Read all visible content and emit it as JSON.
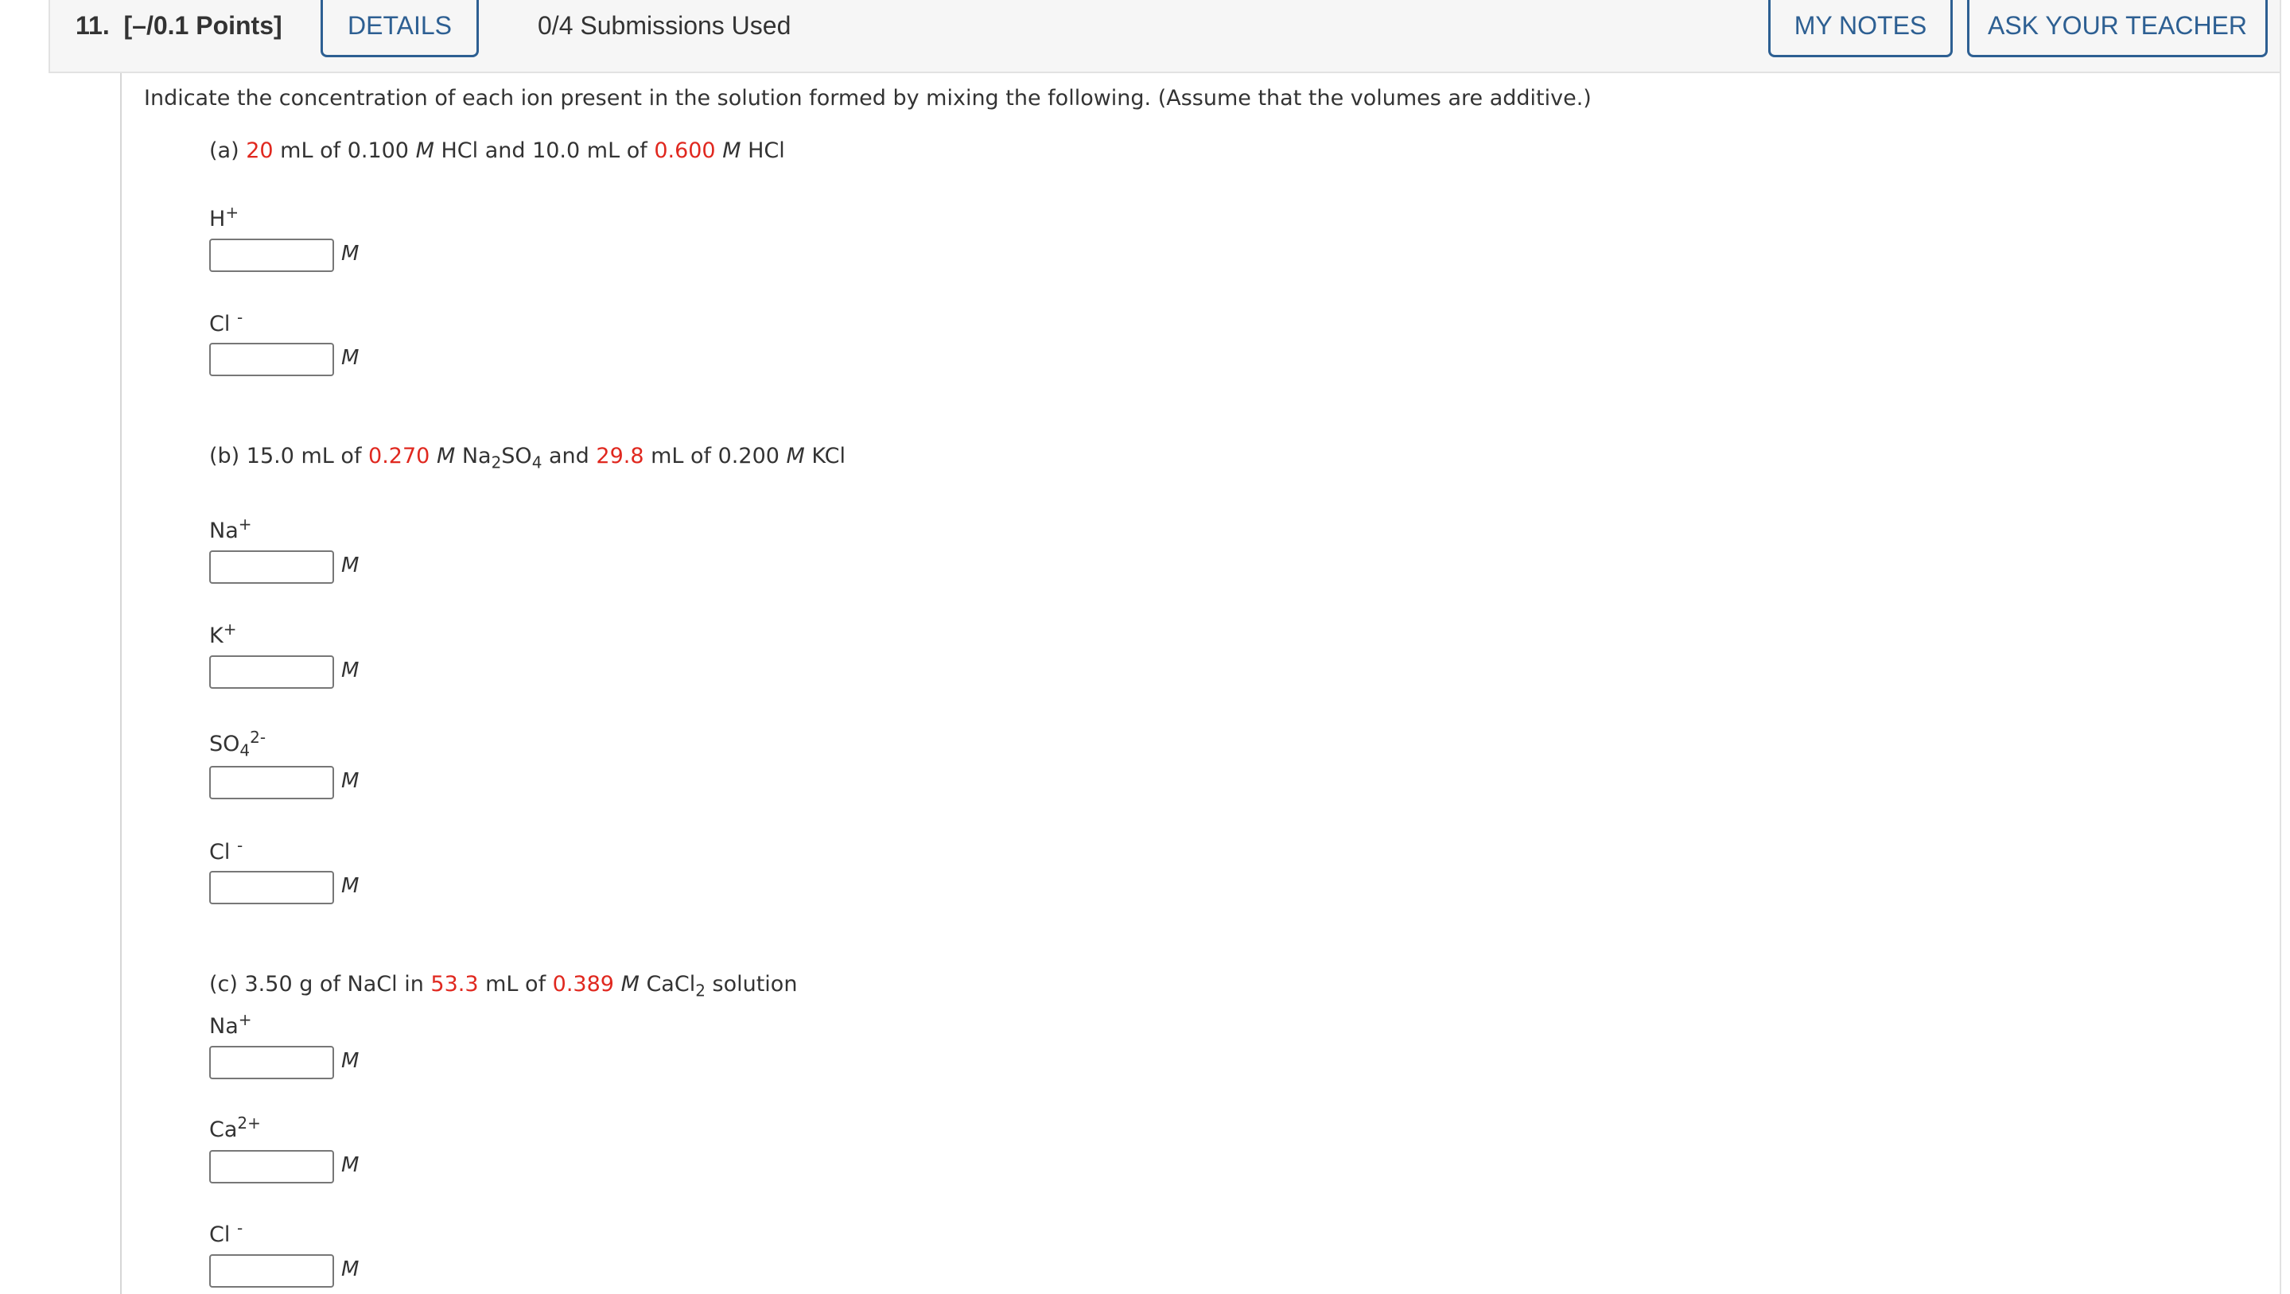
{
  "header": {
    "question_number": "11.",
    "points": "[–/0.1 Points]",
    "details_label": "DETAILS",
    "submissions": "0/4 Submissions Used",
    "my_notes_label": "MY NOTES",
    "ask_teacher_label": "ASK YOUR TEACHER"
  },
  "question": {
    "instruction": "Indicate the concentration of each ion present in the solution formed by mixing the following. (Assume that the volumes are additive.)",
    "unit": "M",
    "parts": [
      {
        "label": "(a)",
        "text": {
          "v1": "20",
          "t1": " mL of 0.100 ",
          "m1": "M",
          "t2": " HCl and 10.0 mL of ",
          "v2": "0.600",
          "t3": " ",
          "m2": "M",
          "t4": " HCl"
        },
        "ions": [
          {
            "base": "H",
            "sub": "",
            "sup": "+",
            "value": ""
          },
          {
            "base": "Cl ",
            "sub": "",
            "sup": "-",
            "value": ""
          }
        ]
      },
      {
        "label": "(b)",
        "text": {
          "t1": " 15.0 mL of ",
          "v1": "0.270",
          "t2": " ",
          "m1": "M",
          "t3": " Na",
          "s1": "2",
          "t4": "SO",
          "s2": "4",
          "t5": " and ",
          "v2": "29.8",
          "t6": " mL of 0.200 ",
          "m2": "M",
          "t7": " KCl"
        },
        "ions": [
          {
            "base": "Na",
            "sub": "",
            "sup": "+",
            "value": ""
          },
          {
            "base": "K",
            "sub": "",
            "sup": "+",
            "value": ""
          },
          {
            "base": "SO",
            "sub": "4",
            "sup": "2-",
            "value": ""
          },
          {
            "base": "Cl ",
            "sub": "",
            "sup": "-",
            "value": ""
          }
        ]
      },
      {
        "label": "(c)",
        "text": {
          "t1": " 3.50 g of NaCl in ",
          "v1": "53.3",
          "t2": " mL of ",
          "v2": "0.389",
          "t3": " ",
          "m1": "M",
          "t4": " CaCl",
          "s1": "2",
          "t5": " solution"
        },
        "ions": [
          {
            "base": "Na",
            "sub": "",
            "sup": "+",
            "value": ""
          },
          {
            "base": "Ca",
            "sub": "",
            "sup": "2+",
            "value": ""
          },
          {
            "base": "Cl ",
            "sub": "",
            "sup": "-",
            "value": ""
          }
        ]
      }
    ]
  },
  "colors": {
    "accent": "#2d5f92",
    "highlight_value": "#e0281f",
    "header_bg": "#f6f6f6"
  }
}
